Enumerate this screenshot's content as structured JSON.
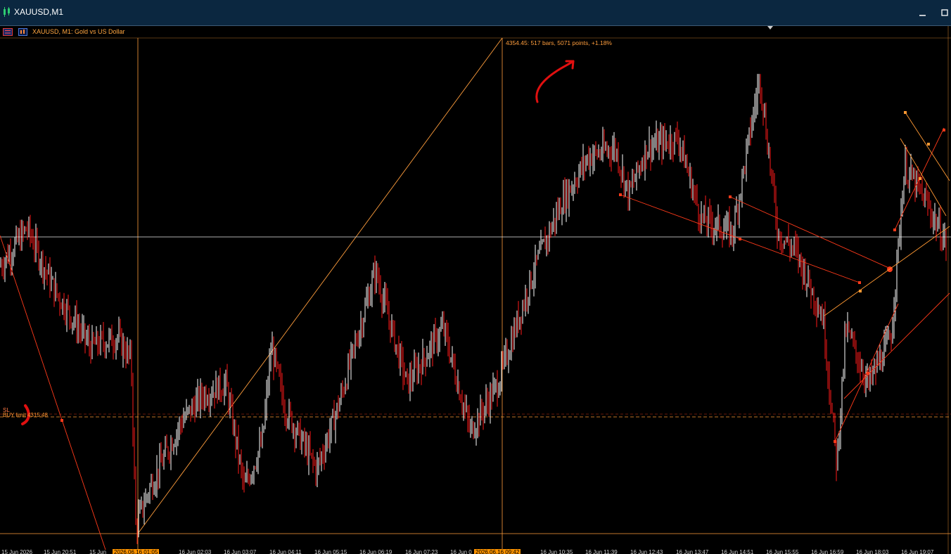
{
  "window": {
    "title": "XAUUSD,M1",
    "icon": "candlestick-icon",
    "controls": [
      "minimize-icon",
      "maximize-icon"
    ]
  },
  "chart_header": {
    "text": "XAUUSD, M1:  Gold vs US Dollar",
    "icons": [
      "one-click-trading-icon",
      "chart-properties-icon"
    ]
  },
  "measure_label": "4354.45: 517 bars, 5071 points, +1.18%",
  "order_line": {
    "sl_label": "SL",
    "label": "BUY limit 4315.48"
  },
  "time_axis": [
    {
      "text": "15 Jun 2026",
      "highlight": false
    },
    {
      "text": "15 Jun 20:51",
      "highlight": false
    },
    {
      "text": "15 Jun",
      "highlight": false
    },
    {
      "text": "2026.06.16 01:05",
      "highlight": true
    },
    {
      "text": "16 Jun 02:03",
      "highlight": false
    },
    {
      "text": "16 Jun 03:07",
      "highlight": false
    },
    {
      "text": "16 Jun 04:11",
      "highlight": false
    },
    {
      "text": "16 Jun 05:15",
      "highlight": false
    },
    {
      "text": "16 Jun 06:19",
      "highlight": false
    },
    {
      "text": "16 Jun 07:23",
      "highlight": false
    },
    {
      "text": "16 Jun 0",
      "highlight": false
    },
    {
      "text": "2026.06.16 09:42",
      "highlight": true
    },
    {
      "text": "16 Jun 10:35",
      "highlight": false
    },
    {
      "text": "16 Jun 11:39",
      "highlight": false
    },
    {
      "text": "16 Jun 12:43",
      "highlight": false
    },
    {
      "text": "16 Jun 13:47",
      "highlight": false
    },
    {
      "text": "16 Jun 14:51",
      "highlight": false
    },
    {
      "text": "16 Jun 15:55",
      "highlight": false
    },
    {
      "text": "16 Jun 16:59",
      "highlight": false
    },
    {
      "text": "16 Jun 18:03",
      "highlight": false
    },
    {
      "text": "16 Jun 19:07",
      "highlight": false
    }
  ],
  "colors": {
    "background": "#000000",
    "bull_candle": "#ffffff",
    "bear_candle": "#ff1a1a",
    "crosshair": "#ff9e3d",
    "order_line": "#ff9933",
    "trendline": "#ff3a1a",
    "annotation": "#e01010"
  },
  "chart_data": {
    "type": "candlestick",
    "symbol": "XAUUSD",
    "timeframe": "M1",
    "x": [
      "15 Jun 2026",
      "15 Jun 20:51",
      "15 Jun",
      "2026.06.16 01:05",
      "16 Jun 02:03",
      "16 Jun 03:07",
      "16 Jun 04:11",
      "16 Jun 05:15",
      "16 Jun 06:19",
      "16 Jun 07:23",
      "16 Jun 0",
      "2026.06.16 09:42",
      "16 Jun 10:35",
      "16 Jun 11:39",
      "16 Jun 12:43",
      "16 Jun 13:47",
      "16 Jun 14:51",
      "16 Jun 15:55",
      "16 Jun 16:59",
      "16 Jun 18:03",
      "16 Jun 19:07"
    ],
    "price_path": [
      [
        0,
        0.55
      ],
      [
        0.6,
        0.63
      ],
      [
        1.2,
        0.5
      ],
      [
        2,
        0.38
      ],
      [
        2.6,
        0.4
      ],
      [
        2.9,
        0.35
      ],
      [
        3,
        0.0
      ],
      [
        3.3,
        0.08
      ],
      [
        4,
        0.22
      ],
      [
        4.5,
        0.28
      ],
      [
        5,
        0.3
      ],
      [
        5.4,
        0.08
      ],
      [
        5.8,
        0.18
      ],
      [
        6,
        0.38
      ],
      [
        6.3,
        0.25
      ],
      [
        7,
        0.12
      ],
      [
        7.5,
        0.26
      ],
      [
        8.3,
        0.54
      ],
      [
        9,
        0.3
      ],
      [
        9.8,
        0.42
      ],
      [
        10.4,
        0.2
      ],
      [
        11,
        0.3
      ],
      [
        11.8,
        0.54
      ],
      [
        12.4,
        0.68
      ],
      [
        13,
        0.78
      ],
      [
        13.6,
        0.8
      ],
      [
        13.9,
        0.7
      ],
      [
        14.3,
        0.8
      ],
      [
        15,
        0.82
      ],
      [
        15.5,
        0.65
      ],
      [
        16.2,
        0.62
      ],
      [
        16.8,
        0.95
      ],
      [
        17.2,
        0.62
      ],
      [
        17.6,
        0.58
      ],
      [
        18.2,
        0.44
      ],
      [
        18.5,
        0.13
      ],
      [
        18.7,
        0.42
      ],
      [
        19.2,
        0.3
      ],
      [
        19.7,
        0.4
      ],
      [
        20,
        0.76
      ],
      [
        20.5,
        0.68
      ],
      [
        21,
        0.58
      ]
    ],
    "measurement": {
      "price": 4354.45,
      "bars": 517,
      "points": 5071,
      "change_percent": 1.18
    },
    "pending_order": {
      "type": "BUY limit",
      "price": 4315.48
    }
  }
}
